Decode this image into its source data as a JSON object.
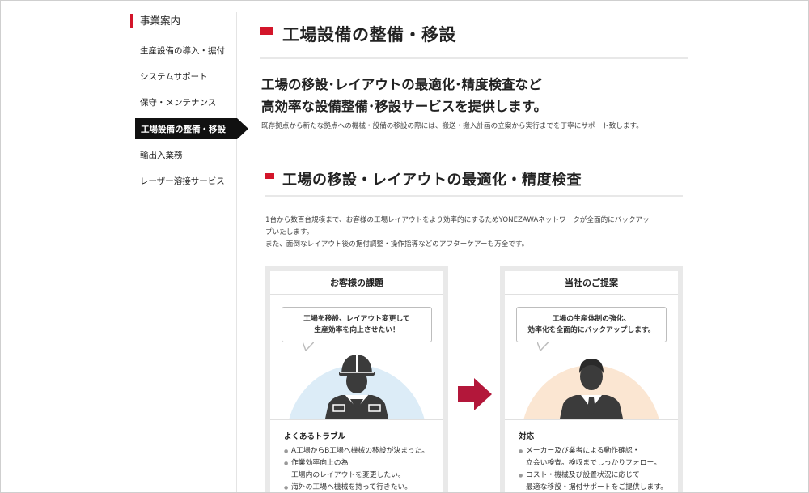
{
  "sidebar": {
    "title": "事業案内",
    "items": [
      {
        "label": "生産設備の導入・据付"
      },
      {
        "label": "システムサポート"
      },
      {
        "label": "保守・メンテナンス"
      },
      {
        "label": "工場設備の整備・移設",
        "active": true
      },
      {
        "label": "輸出入業務"
      },
      {
        "label": "レーザー溶接サービス"
      }
    ]
  },
  "main": {
    "page_title": "工場設備の整備・移設",
    "lead": [
      "工場の移設･レイアウトの最適化･精度検査など",
      "高効率な設備整備･移設サービスを提供します。"
    ],
    "description": "既存拠点から新たな拠点への機械・設備の移設の際には、搬送・搬入計画の立案から実行までを丁寧にサポート致します。",
    "section": {
      "title": "工場の移設・レイアウトの最適化・精度検査",
      "body": [
        "1台から数百台規模まで、お客様の工場レイアウトをより効率的にするためYONEZAWAネットワークが全面的にバックアッ",
        "プいたします。",
        "また、面倒なレイアウト後の据付調整・操作指導などのアフターケアーも万全です。"
      ]
    },
    "cards": {
      "left": {
        "heading": "お客様の課題",
        "bubble": [
          "工場を移設、レイアウト変更して",
          "生産効率を向上させたい！"
        ],
        "figure_icon": "worker-helmet-icon",
        "list_title": "よくあるトラブル",
        "items": [
          {
            "lines": [
              "A工場からB工場へ機械の移設が決まった。"
            ]
          },
          {
            "lines": [
              "作業効率向上の為",
              "工場内のレイアウトを変更したい。"
            ]
          },
          {
            "lines": [
              "海外の工場へ機械を持って行きたい。"
            ]
          }
        ]
      },
      "right": {
        "heading": "当社のご提案",
        "bubble": [
          "工場の生産体制の強化、",
          "効率化を全面的にバックアップします。"
        ],
        "figure_icon": "businessman-icon",
        "list_title": "対応",
        "items": [
          {
            "lines": [
              "メーカー及び業者による動作確認・",
              "立会い検査。検収までしっかりフォロー。"
            ]
          },
          {
            "lines": [
              "コスト・機械及び設置状況に応じて",
              "最適な移設・据付サポートをご提供します。"
            ]
          }
        ]
      }
    }
  },
  "colors": {
    "accent": "#d3152a",
    "arrow": "#b3173a",
    "active_nav": "#111111",
    "left_glow": "#dcecf7",
    "right_glow": "#fbe6d2"
  }
}
